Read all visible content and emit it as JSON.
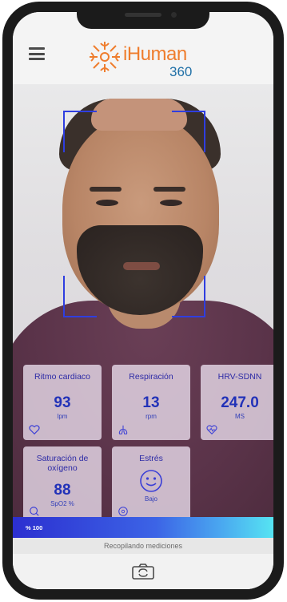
{
  "header": {
    "menu_icon": "hamburger-menu-icon",
    "logo": {
      "brand": "iHuman",
      "suffix": "360",
      "brand_color": "#ef7d2d",
      "suffix_color": "#1f6fa6"
    }
  },
  "camera": {
    "face_box_color": "#2c3bd8"
  },
  "metrics": [
    {
      "title": "Ritmo cardiaco",
      "value": "93",
      "unit": "lpm",
      "icon": "heart-icon"
    },
    {
      "title": "Respiración",
      "value": "13",
      "unit": "rpm",
      "icon": "lungs-icon"
    },
    {
      "title": "HRV-SDNN",
      "value": "247.0",
      "unit": "MS",
      "icon": "heart-pulse-icon"
    },
    {
      "title": "Saturación de oxígeno",
      "value": "88",
      "unit": "SpO2 %",
      "icon": "oxygen-icon"
    },
    {
      "title": "Estrés",
      "value": "",
      "unit": "Bajo",
      "icon": "smiley-face-icon"
    }
  ],
  "progress": {
    "label": "% 100",
    "percent": 100
  },
  "status": {
    "text": "Recopilando mediciones"
  },
  "bottom": {
    "switch_camera_icon": "switch-camera-icon"
  }
}
